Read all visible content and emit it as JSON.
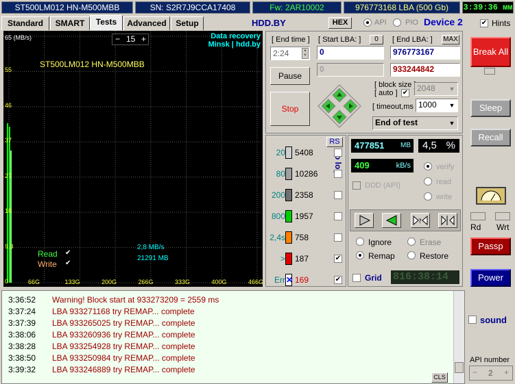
{
  "infobar": {
    "model": "ST500LM012 HN-M500MBB",
    "serial": "SN: S2R7J9CCA17408",
    "firmware": "Fw: 2AR10002",
    "capacity": "976773168 LBA (500 Gb)",
    "clock": "3:39:36 мм"
  },
  "tabs": [
    "Standard",
    "SMART",
    "Tests",
    "Advanced",
    "Setup"
  ],
  "active_tab": "Tests",
  "topbar": {
    "site": "HDD.BY",
    "hex_label": "HEX",
    "api_label": "API",
    "pio_label": "PIO",
    "device": "Device 2",
    "hints_label": "Hints",
    "hints_checked": "✔"
  },
  "graph": {
    "y_labels": [
      "65 (MB/s)",
      "55",
      "46",
      "37",
      "27",
      "18",
      "9,3",
      "0"
    ],
    "x_labels": [
      "66G",
      "133G",
      "200G",
      "266G",
      "333G",
      "400G",
      "466G"
    ],
    "zoom_minus": "−",
    "zoom_value": "15",
    "zoom_plus": "+",
    "promo_line1": "Data recovery",
    "promo_line2": "Minsk | hdd.by",
    "drive_label": "ST500LM012 HN-M500MBB",
    "read_label": "Read",
    "write_label": "Write",
    "speed": "2,8 MB/s",
    "processed": "21291 MB",
    "check": "✔"
  },
  "controls": {
    "end_time_label": "[ End time ]",
    "end_time_value": "2:24",
    "start_lba_label": "[ Start LBA: ]",
    "start_lba_zero": "0",
    "start_lba_value": "0",
    "start_lba_current": "0",
    "end_lba_label": "[ End LBA: ]",
    "max_label": "MAX",
    "end_lba_value": "976773167",
    "end_lba_current": "933244842",
    "pause_label": "Pause",
    "stop_label": "Stop",
    "block_size_label": "[ block size ]",
    "auto_label": "[ auto ]",
    "auto_check": "✔",
    "block_size_value": "2048",
    "timeout_label": "[ timeout,ms ]",
    "timeout_value": "1000",
    "end_action": "End of test"
  },
  "stats": {
    "rs_label": "RS",
    "to_log": "to log:",
    "rows": [
      {
        "threshold": "20",
        "count": "5408",
        "color": "#d0d0d0",
        "log": ""
      },
      {
        "threshold": "80",
        "count": "10286",
        "color": "#a0a0a0",
        "log": ""
      },
      {
        "threshold": "200",
        "count": "2358",
        "color": "#707070",
        "log": ""
      },
      {
        "threshold": "800",
        "count": "1957",
        "color": "#00d000",
        "log": ""
      },
      {
        "threshold": "2,4s",
        "count": "758",
        "color": "#ff8000",
        "log": ""
      },
      {
        "threshold": ">",
        "count": "187",
        "color": "#e00000",
        "log": "✔"
      },
      {
        "threshold": "Err",
        "count": "169",
        "color": "#0000ff",
        "log": "✔"
      }
    ]
  },
  "progress": {
    "mb_value": "477851",
    "mb_unit": "MB",
    "percent": "4,5",
    "percent_unit": "%",
    "speed_value": "409",
    "speed_unit": "kB/s",
    "ddd_label": "DDD (API)",
    "verify_label": "verify",
    "read_label": "read",
    "write_label": "write",
    "ignore_label": "Ignore",
    "erase_label": "Erase",
    "remap_label": "Remap",
    "restore_label": "Restore",
    "grid_label": "Grid",
    "grid_time": "816:38:14"
  },
  "right": {
    "break_all": "Break All",
    "sleep": "Sleep",
    "recall": "Recall",
    "rd": "Rd",
    "wrt": "Wrt",
    "passp": "Passp",
    "power": "Power",
    "sound": "sound",
    "api_number_label": "API number",
    "api_number": "2"
  },
  "log": {
    "cls": "CLS",
    "entries": [
      {
        "time": "3:36:52",
        "msg": "Warning! Block start at 933273209 = 2559 ms"
      },
      {
        "time": "3:37:24",
        "msg": "LBA 933271168 try REMAP... complete"
      },
      {
        "time": "3:37:39",
        "msg": "LBA 933265025 try REMAP... complete"
      },
      {
        "time": "3:38:06",
        "msg": "LBA 933260936 try REMAP... complete"
      },
      {
        "time": "3:38:28",
        "msg": "LBA 933254928 try REMAP... complete"
      },
      {
        "time": "3:38:50",
        "msg": "LBA 933250984 try REMAP... complete"
      },
      {
        "time": "3:39:32",
        "msg": "LBA 933246889 try REMAP... complete"
      }
    ]
  }
}
